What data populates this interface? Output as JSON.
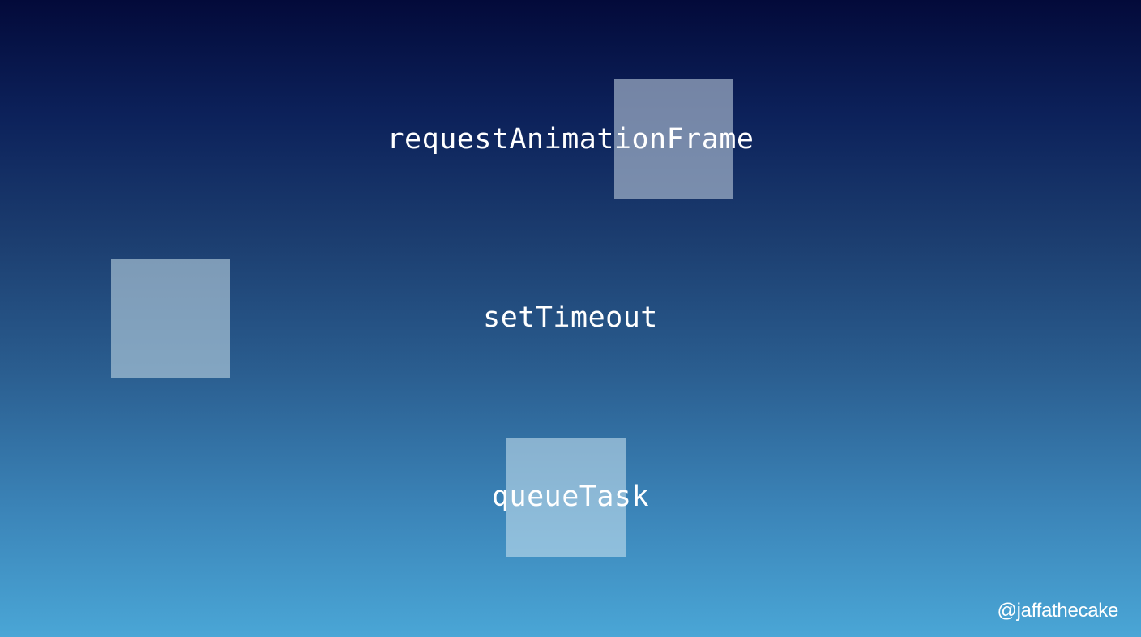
{
  "slide": {
    "labels": {
      "raf": "requestAnimationFrame",
      "timeout": "setTimeout",
      "queue": "queueTask"
    },
    "handle": "@jaffathecake"
  },
  "colors": {
    "gradient_top": "#030a3a",
    "gradient_bottom": "#4aa6d6",
    "text": "#ffffff"
  }
}
